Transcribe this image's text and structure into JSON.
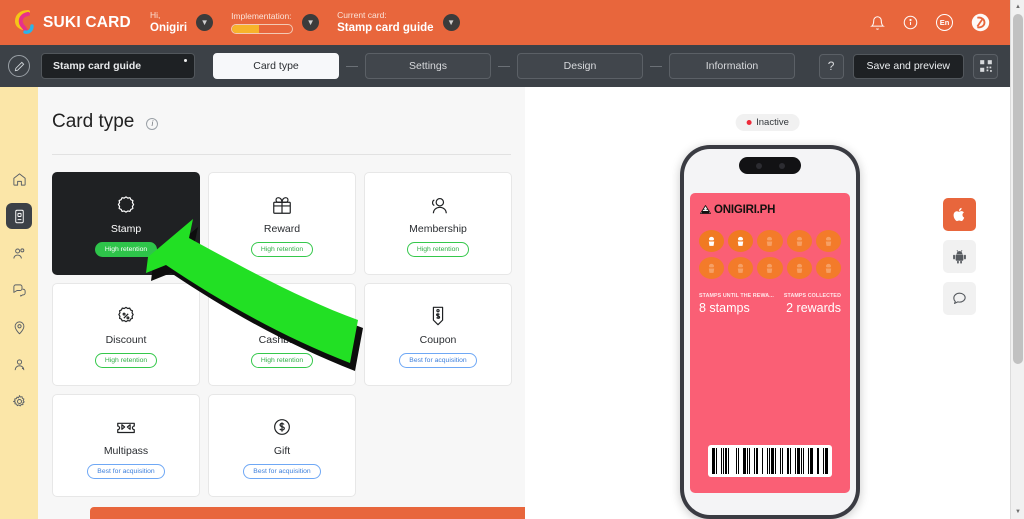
{
  "header": {
    "brand": "SUKI CARD",
    "greeting_label": "Hi,",
    "greeting_value": "Onigiri",
    "implementation_label": "Implementation:",
    "implementation_percent": 45,
    "current_card_label": "Current card:",
    "current_card_value": "Stamp card guide",
    "icons": {
      "bell": "bell-icon",
      "info": "info-icon",
      "lang": "En",
      "account": "account-logo-icon"
    },
    "accent_color": "#e8663c"
  },
  "toolbar": {
    "edit_icon": "pencil-icon",
    "card_name": "Stamp card guide",
    "steps": [
      {
        "label": "Card type",
        "active": true
      },
      {
        "label": "Settings",
        "active": false
      },
      {
        "label": "Design",
        "active": false
      },
      {
        "label": "Information",
        "active": false
      }
    ],
    "help_label": "?",
    "save_label": "Save and preview",
    "qr_icon": "qr-code-icon"
  },
  "sidebar": {
    "items": [
      {
        "name": "home",
        "icon": "home-icon",
        "active": false
      },
      {
        "name": "cards",
        "icon": "card-icon",
        "active": true
      },
      {
        "name": "customers",
        "icon": "users-icon",
        "active": false
      },
      {
        "name": "messages",
        "icon": "chat-icon",
        "active": false
      },
      {
        "name": "locations",
        "icon": "pin-icon",
        "active": false
      },
      {
        "name": "staff",
        "icon": "user-icon",
        "active": false
      },
      {
        "name": "settings",
        "icon": "gear-icon",
        "active": false
      }
    ]
  },
  "main": {
    "title": "Card type",
    "info_icon": "info-icon",
    "card_types": [
      {
        "label": "Stamp",
        "icon": "stamp-icon",
        "badge": "High retention",
        "badge_type": "retention",
        "selected": true
      },
      {
        "label": "Reward",
        "icon": "gift-icon",
        "badge": "High retention",
        "badge_type": "retention",
        "selected": false
      },
      {
        "label": "Membership",
        "icon": "membership-icon",
        "badge": "High retention",
        "badge_type": "retention",
        "selected": false
      },
      {
        "label": "Discount",
        "icon": "percent-icon",
        "badge": "High retention",
        "badge_type": "retention",
        "selected": false
      },
      {
        "label": "Cashback",
        "icon": "coin-icon",
        "badge": "High retention",
        "badge_type": "retention",
        "selected": false
      },
      {
        "label": "Coupon",
        "icon": "tag-icon",
        "badge": "Best for acquisition",
        "badge_type": "acquisition",
        "selected": false
      },
      {
        "label": "Multipass",
        "icon": "ticket-icon",
        "badge": "Best for acquisition",
        "badge_type": "acquisition",
        "selected": false
      },
      {
        "label": "Gift",
        "icon": "dollar-coin-icon",
        "badge": "Best for acquisition",
        "badge_type": "acquisition",
        "selected": false
      }
    ]
  },
  "annotation": {
    "arrow": "green-arrow-pointing-to-stamp",
    "color": "#22e024"
  },
  "preview": {
    "status": "Inactive",
    "status_color": "#ee2b3a",
    "card": {
      "logo_text": "ONIGIRI.PH",
      "logo_icon": "onigiri-icon",
      "background_color": "#fa5f75",
      "stamps_total": 10,
      "stamps_filled": 2,
      "stamp_icon": "cupcake-icon",
      "stat_left_label": "STAMPS UNTIL THE REWA...",
      "stat_left_value": "8 stamps",
      "stat_right_label": "STAMPS COLLECTED",
      "stat_right_value": "2 rewards",
      "barcode": "barcode-icon"
    },
    "platform_buttons": [
      {
        "name": "apple",
        "icon": "apple-icon",
        "active": true
      },
      {
        "name": "android",
        "icon": "android-icon",
        "active": false
      },
      {
        "name": "chat",
        "icon": "chat-icon",
        "active": false
      }
    ]
  },
  "scrollbar": {
    "up": "▲",
    "down": "▼"
  }
}
